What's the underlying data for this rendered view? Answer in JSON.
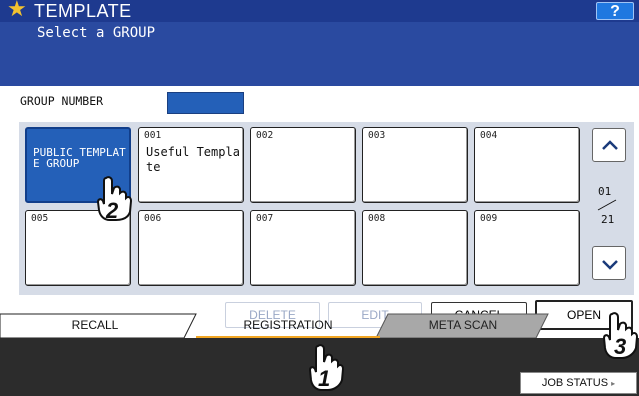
{
  "header": {
    "title": "TEMPLATE",
    "help_label": "?",
    "subtitle": "Select a GROUP"
  },
  "group_number": {
    "label": "GROUP NUMBER",
    "value": ""
  },
  "tiles": [
    {
      "number": "",
      "name": "PUBLIC TEMPLATE GROUP",
      "selected": true
    },
    {
      "number": "001",
      "name": "Useful Template"
    },
    {
      "number": "002",
      "name": ""
    },
    {
      "number": "003",
      "name": ""
    },
    {
      "number": "004",
      "name": ""
    },
    {
      "number": "005",
      "name": ""
    },
    {
      "number": "006",
      "name": ""
    },
    {
      "number": "007",
      "name": ""
    },
    {
      "number": "008",
      "name": ""
    },
    {
      "number": "009",
      "name": ""
    }
  ],
  "pagination": {
    "current": "01",
    "total": "21"
  },
  "actions": {
    "delete_label": "DELETE",
    "edit_label": "EDIT",
    "cancel_label": "CANCEL",
    "open_label": "OPEN"
  },
  "tabs": {
    "recall": "RECALL",
    "registration": "REGISTRATION",
    "meta_scan": "META SCAN"
  },
  "footer": {
    "job_status_label": "JOB STATUS"
  },
  "callouts": {
    "one": "1",
    "two": "2",
    "three": "3"
  },
  "colors": {
    "title_bar": "#1e3a8f",
    "subbar": "#2a4aa0",
    "selected_tile": "#2460b8",
    "accent": "#f2a623"
  }
}
